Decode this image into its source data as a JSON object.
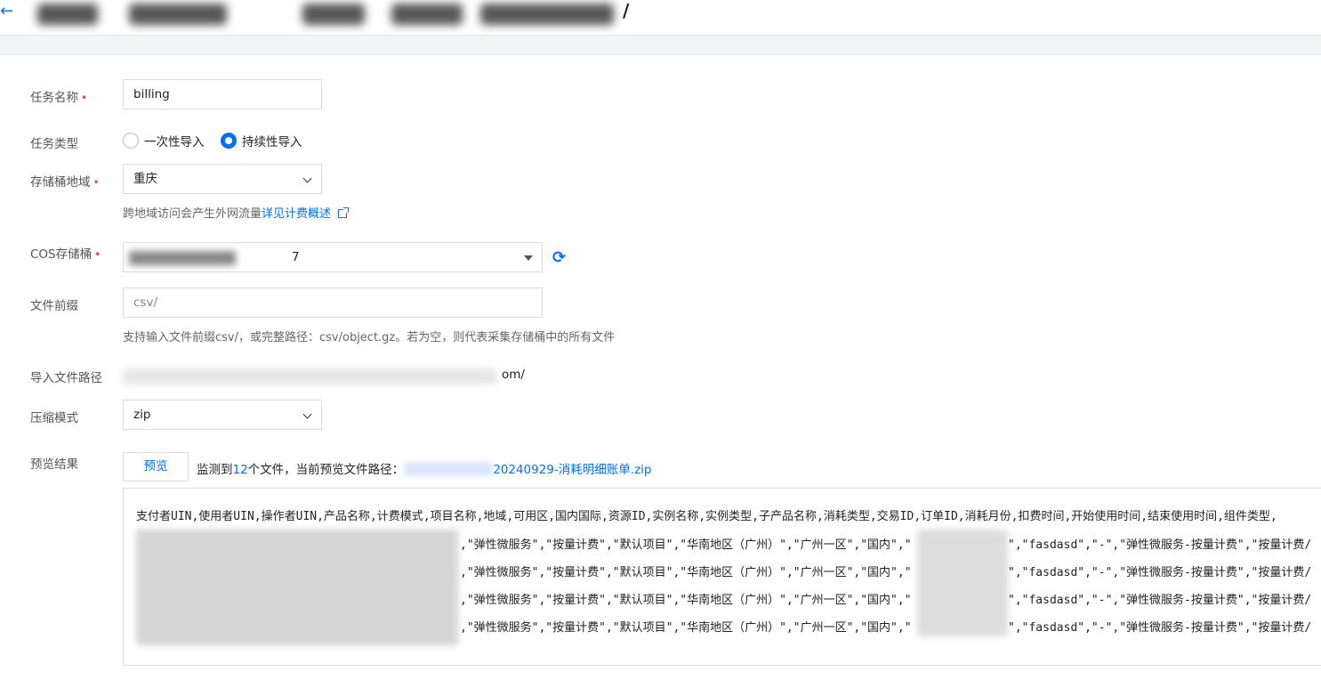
{
  "header": {
    "title_tail": "/"
  },
  "form": {
    "task_name": {
      "label": "任务名称",
      "value": "billing"
    },
    "task_type": {
      "label": "任务类型",
      "options": [
        {
          "label": "一次性导入",
          "selected": false
        },
        {
          "label": "持续性导入",
          "selected": true
        }
      ]
    },
    "region": {
      "label": "存储桶地域",
      "value": "重庆",
      "hint_text": "跨地域访问会产生外网流量",
      "hint_link": "详见计费概述"
    },
    "bucket": {
      "label": "COS存储桶",
      "value_tail": "7"
    },
    "prefix": {
      "label": "文件前缀",
      "placeholder": "csv/",
      "hint": "支持输入文件前缀csv/，或完整路径：csv/object.gz。若为空，则代表采集存储桶中的所有文件"
    },
    "import_path": {
      "label": "导入文件路径",
      "value_tail": "om/"
    },
    "compression": {
      "label": "压缩模式",
      "value": "zip"
    },
    "preview": {
      "label": "预览结果",
      "button": "预览",
      "info_prefix": "监测到",
      "file_count": "12",
      "info_middle": "个文件，当前预览文件路径：",
      "file_path_tail": "20240929-消耗明细账单.zip"
    }
  },
  "result": {
    "header_line": "支付者UIN,使用者UIN,操作者UIN,产品名称,计费模式,项目名称,地域,可用区,国内国际,资源ID,实例名称,实例类型,子产品名称,消耗类型,交易ID,订单ID,消耗月份,扣费时间,开始使用时间,结束使用时间,组件类型,",
    "row_mid": ",\"弹性微服务\",\"按量计费\",\"默认项目\",\"华南地区（广州）\",\"广州一区\",\"国内\",\"",
    "rows_tail": [
      "\",\"fasdasd\",\"-\",\"弹性微服务-按量计费\",\"按量计费/",
      "\",\"fasdasd\",\"-\",\"弹性微服务-按量计费\",\"按量计费/",
      "\",\"fasdasd\",\"-\",\"弹性微服务-按量计费\",\"按量计费/",
      "\",\"fasdasd\",\"-\",\"弹性微服务-按量计费\",\"按量计费/"
    ]
  },
  "icons": {
    "back": "back-arrow-icon",
    "refresh": "refresh-icon",
    "external": "external-link-icon",
    "dropdown": "chevron-down-icon"
  },
  "colors": {
    "accent": "#006eff",
    "required": "#e54545"
  }
}
